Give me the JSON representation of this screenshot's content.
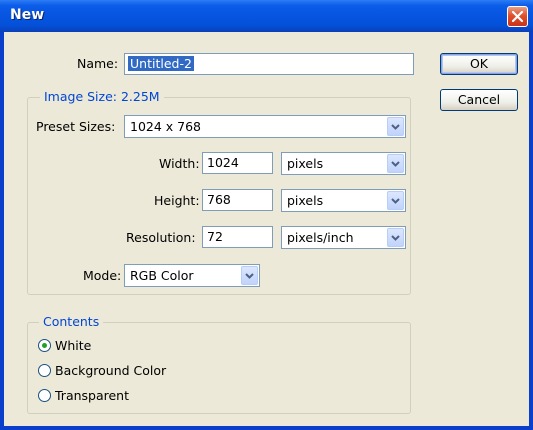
{
  "window": {
    "title": "New"
  },
  "name": {
    "label": "Name:",
    "value": "Untitled-2"
  },
  "buttons": {
    "ok": "OK",
    "cancel": "Cancel"
  },
  "image_size": {
    "legend": "Image Size: 2.25M",
    "preset": {
      "label": "Preset Sizes:",
      "value": "1024 x 768"
    },
    "width": {
      "label": "Width:",
      "value": "1024",
      "unit": "pixels"
    },
    "height": {
      "label": "Height:",
      "value": "768",
      "unit": "pixels"
    },
    "resolution": {
      "label": "Resolution:",
      "value": "72",
      "unit": "pixels/inch"
    },
    "mode": {
      "label": "Mode:",
      "value": "RGB Color"
    }
  },
  "contents": {
    "legend": "Contents",
    "options": [
      {
        "label": "White",
        "checked": true
      },
      {
        "label": "Background Color",
        "checked": false
      },
      {
        "label": "Transparent",
        "checked": false
      }
    ]
  },
  "colors": {
    "titlebar": "#0654e0",
    "dialog_bg": "#ece9d8",
    "accent_text": "#0046d5",
    "selection": "#316ac5",
    "close_button": "#e0502c"
  }
}
